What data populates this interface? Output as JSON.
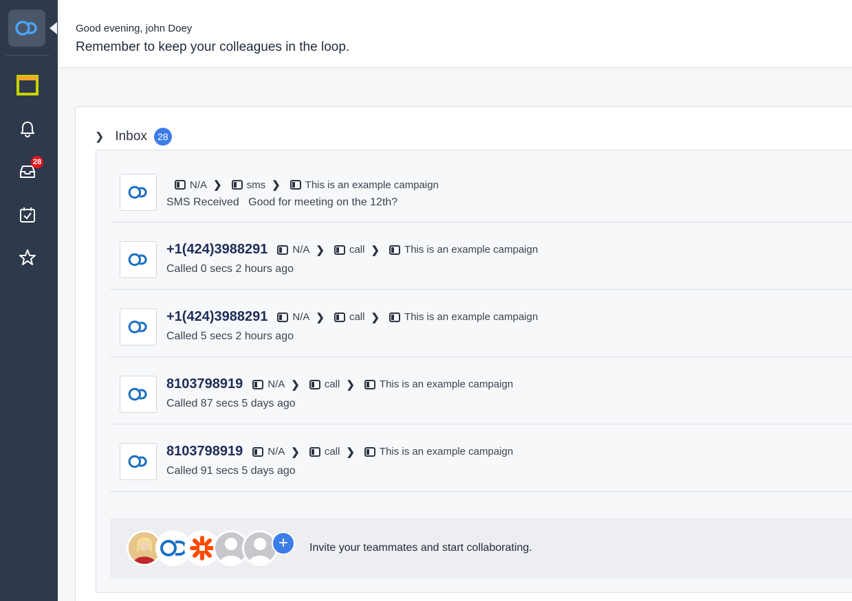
{
  "sidebar": {
    "items": [
      {
        "name": "dashboard",
        "icon": "square-outline-icon"
      },
      {
        "name": "notifications",
        "icon": "bell-icon"
      },
      {
        "name": "inbox",
        "icon": "inbox-tray-icon",
        "badge": "28"
      },
      {
        "name": "tasks",
        "icon": "calendar-check-icon"
      },
      {
        "name": "favorites",
        "icon": "star-icon"
      }
    ]
  },
  "header": {
    "greeting": "Good evening, john Doey",
    "subtitle": "Remember to keep your colleagues in the loop."
  },
  "inbox": {
    "title": "Inbox",
    "count": "28",
    "items": [
      {
        "phone": "",
        "crumb1": "N/A",
        "crumb2": "sms",
        "crumb3": "This is an example campaign",
        "detail": "SMS Received   Good for meeting on the 12th?"
      },
      {
        "phone": "+1(424)3988291",
        "crumb1": "N/A",
        "crumb2": "call",
        "crumb3": "This is an example campaign",
        "detail": "Called 0 secs 2 hours ago"
      },
      {
        "phone": "+1(424)3988291",
        "crumb1": "N/A",
        "crumb2": "call",
        "crumb3": "This is an example campaign",
        "detail": "Called 5 secs 2 hours ago"
      },
      {
        "phone": "8103798919",
        "crumb1": "N/A",
        "crumb2": "call",
        "crumb3": "This is an example campaign",
        "detail": "Called 87 secs 5 days ago"
      },
      {
        "phone": "8103798919",
        "crumb1": "N/A",
        "crumb2": "call",
        "crumb3": "This is an example campaign",
        "detail": "Called 91 secs 5 days ago"
      }
    ]
  },
  "invite": {
    "text": "Invite your teammates and start collaborating.",
    "plus": "+"
  },
  "colors": {
    "sidebar": "#2e3a4b",
    "accent": "#3d7de8",
    "badge": "#e4141b",
    "logo_blue": "#1a6fc4"
  }
}
